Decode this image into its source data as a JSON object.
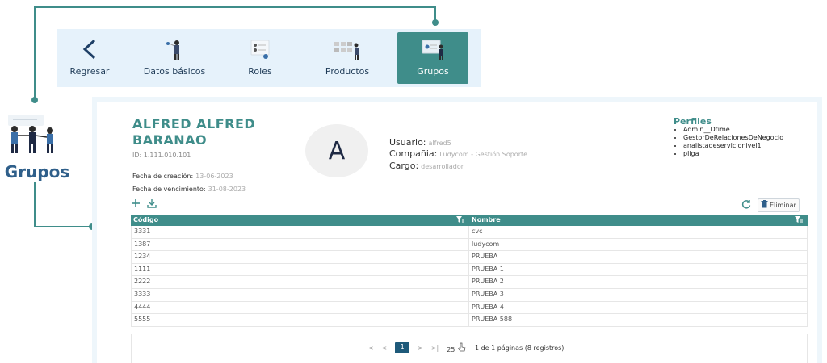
{
  "callout_label": "Grupos",
  "nav": {
    "items": [
      {
        "label": "Regresar",
        "icon": "chevron-left-icon"
      },
      {
        "label": "Datos básicos",
        "icon": "person-data-icon"
      },
      {
        "label": "Roles",
        "icon": "roles-icon"
      },
      {
        "label": "Productos",
        "icon": "products-icon"
      },
      {
        "label": "Grupos",
        "icon": "groups-icon",
        "active": true
      }
    ]
  },
  "user": {
    "name": "ALFRED ALFRED BARANAO",
    "id": "ID: 1.111.010.101",
    "creation_label": "Fecha de creación:",
    "creation_value": "13-06-2023",
    "expiry_label": "Fecha de vencimiento:",
    "expiry_value": "31-08-2023",
    "avatar_letter": "A",
    "usuario_label": "Usuario:",
    "usuario_value": "alfred5",
    "compania_label": "Compañia:",
    "compania_value": "Ludycom - Gestión Soporte",
    "cargo_label": "Cargo:",
    "cargo_value": "desarrollador"
  },
  "perfiles": {
    "title": "Perfiles",
    "items": [
      "Admin__Dtime",
      "GestorDeRelacionesDeNegocio",
      "analistadeservicionivel1",
      "pliga"
    ]
  },
  "actions": {
    "delete_label": "Eliminar"
  },
  "table": {
    "columns": [
      "Código",
      "Nombre"
    ],
    "rows": [
      [
        "3331",
        "cvc"
      ],
      [
        "1387",
        "ludycom"
      ],
      [
        "1234",
        "PRUEBA"
      ],
      [
        "1111",
        "PRUEBA 1"
      ],
      [
        "2222",
        "PRUEBA 2"
      ],
      [
        "3333",
        "PRUEBA 3"
      ],
      [
        "4444",
        "PRUEBA 4"
      ],
      [
        "5555",
        "PRUEBA 588"
      ]
    ]
  },
  "pagination": {
    "first": "|<",
    "prev": "<",
    "current_page": "1",
    "next": ">",
    "last": ">|",
    "page_size": "25",
    "summary": "1 de 1 páginas (8 registros)"
  },
  "colors": {
    "accent": "#3f8d8a",
    "nav_bg": "#e6f2fb",
    "pager_active": "#1e5a7a"
  }
}
